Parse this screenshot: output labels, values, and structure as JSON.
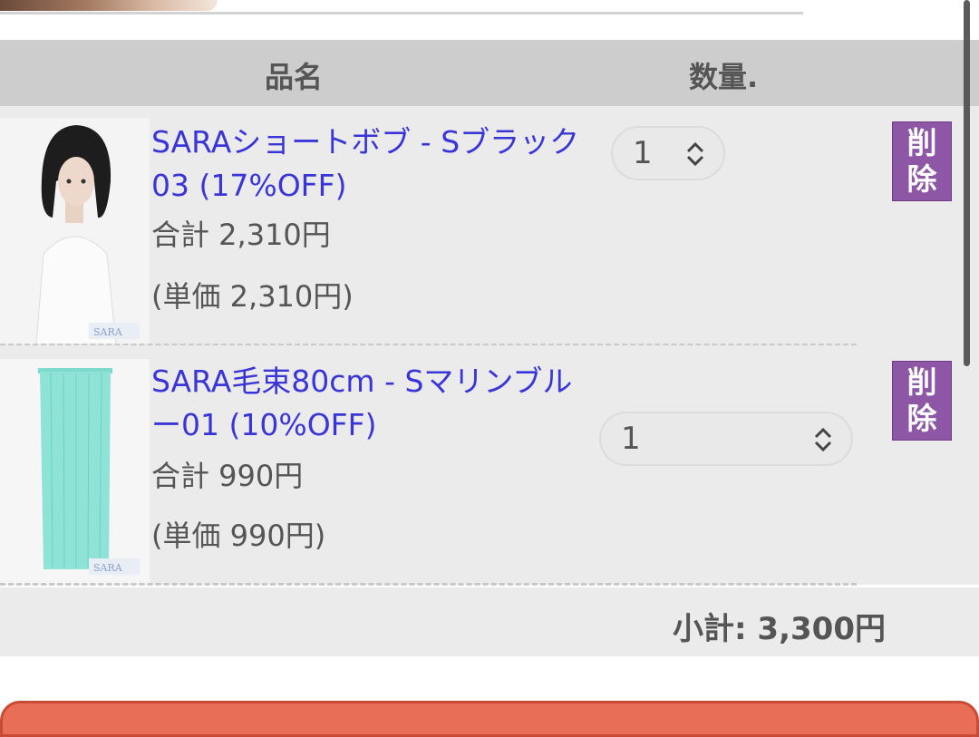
{
  "header": {
    "name_label": "品名",
    "qty_label": "数量."
  },
  "items": [
    {
      "name": "SARAショートボブ - Sブラック03 (17%OFF)",
      "total": "合計 2,310円",
      "unit_price": "(単価 2,310円)",
      "quantity": "1",
      "delete_label": "削除",
      "thumb_alt": "ショートボブ黒ウィッグ着用マネキン"
    },
    {
      "name": "SARA毛束80cm - Sマリンブルー01 (10%OFF)",
      "total": "合計 990円",
      "unit_price": "(単価 990円)",
      "quantity": "1",
      "delete_label": "削除",
      "thumb_alt": "マリンブルー毛束"
    }
  ],
  "subtotal": "小計: 3,300円",
  "colors": {
    "link": "#3a35d6",
    "delete": "#8e57a6",
    "checkout": "#e86f55"
  }
}
